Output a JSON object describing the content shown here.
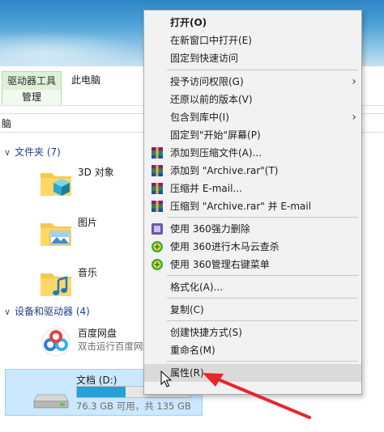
{
  "ribbon": {
    "drive_tools_tab": "驱动器工具",
    "this_pc_tab": "此电脑",
    "manage_tab": "管理"
  },
  "address": {
    "text": "脑"
  },
  "folders": {
    "header": "文件夹 (7)",
    "items": [
      {
        "label": "3D 对象"
      },
      {
        "label": "图片"
      },
      {
        "label": "音乐"
      }
    ]
  },
  "devices": {
    "header": "设备和驱动器 (4)",
    "items": [
      {
        "label": "百度网盘",
        "sublabel": "双击运行百度网"
      },
      {
        "label": "文档 (D:)",
        "sublabel": "76.3 GB 可用，共 135 GB",
        "used_fraction": 0.43
      }
    ]
  },
  "context_menu": {
    "open": "打开(O)",
    "open_new_window": "在新窗口中打开(E)",
    "pin_quick_access": "固定到快速访问",
    "grant_access": "授予访问权限(G)",
    "restore_versions": "还原以前的版本(V)",
    "include_library": "包含到库中(I)",
    "pin_start": "固定到\"开始\"屏幕(P)",
    "add_archive": "添加到压缩文件(A)...",
    "add_archive_rar": "添加到 \"Archive.rar\"(T)",
    "compress_email": "压缩并 E-mail...",
    "compress_rar_email": "压缩到 \"Archive.rar\" 并 E-mail",
    "delete_360": "使用 360强力删除",
    "scan_360": "使用 360进行木马云查杀",
    "menu_360": "使用 360管理右键菜单",
    "format": "格式化(A)...",
    "copy": "复制(C)",
    "create_shortcut": "创建快捷方式(S)",
    "rename": "重命名(M)",
    "properties": "属性(R)"
  },
  "colors": {
    "selection": "#cce8ff",
    "progress": "#26a0da",
    "annotation_arrow": "#e8262b",
    "drive_tools_tab": "#dff0d8"
  }
}
